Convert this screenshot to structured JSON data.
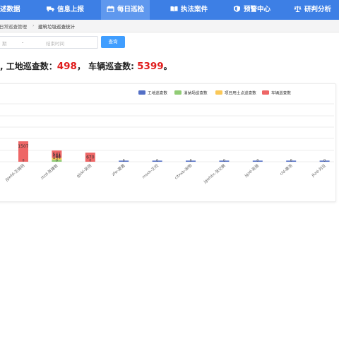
{
  "nav": {
    "items": [
      {
        "label": "述数据"
      },
      {
        "label": "信息上报",
        "icon": "truck-icon"
      },
      {
        "label": "每日巡检",
        "icon": "calendar-icon"
      },
      {
        "label": "执法案件",
        "icon": "book-icon"
      },
      {
        "label": "预警中心",
        "icon": "shield-icon"
      },
      {
        "label": "研判分析",
        "icon": "scale-icon"
      }
    ],
    "active_index": 2,
    "colors": {
      "bar": "#3d7fe5",
      "active": "#5f98ee"
    }
  },
  "breadcrumb": {
    "items": [
      "日常巡查管理",
      "建筑垃圾巡查统计"
    ]
  },
  "filter": {
    "start_placeholder": "期",
    "separator": "-",
    "end_placeholder": "结束时间",
    "query_label": "查询"
  },
  "summary": {
    "prefix": ", 工地巡查数：",
    "site_count": "498",
    "mid": "，  车辆巡查数: ",
    "vehicle_count": "5399",
    "suffix": "。"
  },
  "chart_data": {
    "type": "bar",
    "stacked": true,
    "categories": [
      "jgwfd-王婧玥",
      "ztzd-张建新",
      "gjskl-吴丽",
      "zfw-夏茜",
      "msxh-王欣",
      "cltxxb-宋明",
      "jgwhbc-张记枫",
      "jgzd-吴振",
      "cld-康浩",
      "jkzd-刘旦",
      "jxcg-江霞"
    ],
    "series": [
      {
        "name": "工地巡查数",
        "color": "#5470c6",
        "values": [
          0,
          0,
          0,
          10,
          5,
          2,
          1,
          1,
          1,
          1,
          1
        ]
      },
      {
        "name": "消纳场巡查数",
        "color": "#91cc75",
        "values": [
          0,
          144,
          0,
          0,
          0,
          0,
          0,
          0,
          0,
          0,
          0
        ]
      },
      {
        "name": "项目用土点巡查数",
        "color": "#fac858",
        "values": [
          0,
          144,
          0,
          0,
          0,
          0,
          0,
          0,
          0,
          0,
          0
        ]
      },
      {
        "name": "车辆巡查数",
        "color": "#ee6666",
        "values": [
          1507,
          541,
          670,
          0,
          0,
          0,
          0,
          0,
          0,
          0,
          0
        ]
      }
    ],
    "data_labels": [
      {
        "category": "jgwfd-王婧玥",
        "series": "车辆巡查数",
        "text": "1507"
      },
      {
        "category": "ztzd-张建新",
        "series": "车辆巡查数",
        "text": "541"
      },
      {
        "category": "ztzd-张建新",
        "series": "项目用土点巡查数",
        "text": "144"
      },
      {
        "category": "ztzd-张建新",
        "series": "消纳场巡查数",
        "text": "144"
      },
      {
        "category": "gjskl-吴丽",
        "series": "车辆巡查数",
        "text": "670"
      }
    ],
    "legend_position": "top-right",
    "grid": true
  }
}
